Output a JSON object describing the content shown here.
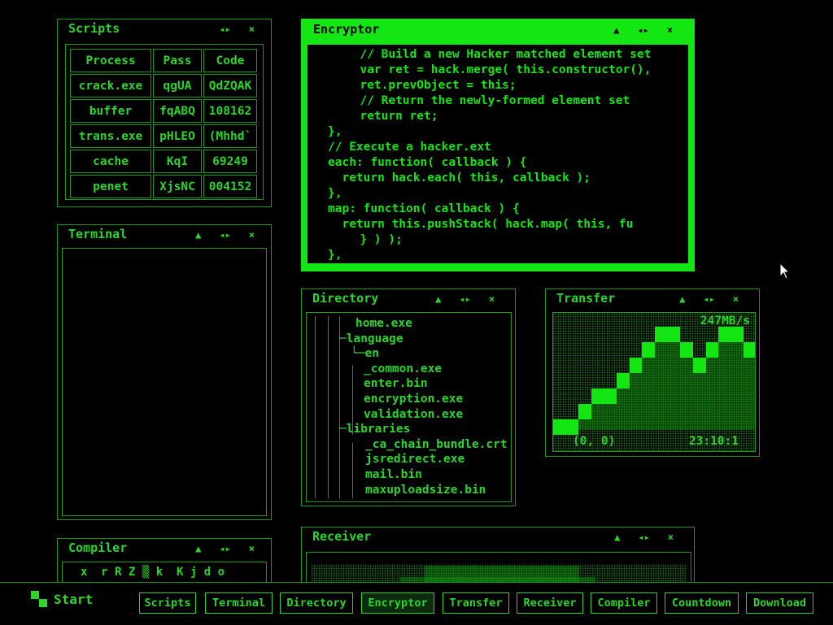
{
  "windows": {
    "scripts": {
      "title": "Scripts",
      "controls": [
        "◂▸",
        "×"
      ],
      "table": {
        "headers": [
          "Process",
          "Pass",
          "Code"
        ],
        "rows": [
          [
            "crack.exe",
            "qgUA",
            "QdZQAK"
          ],
          [
            "buffer",
            "fqABQ",
            "108162"
          ],
          [
            "trans.exe",
            "pHLEO",
            "(Mhhd`"
          ],
          [
            "cache",
            "KqI",
            "69249"
          ],
          [
            "penet",
            "XjsNC",
            "004152"
          ]
        ]
      }
    },
    "terminal": {
      "title": "Terminal",
      "controls": [
        "▲",
        "◂▸",
        "×"
      ]
    },
    "compiler": {
      "title": "Compiler",
      "controls": [
        "▲",
        "◂▸",
        "×"
      ],
      "text": "x  r R Z ▒ k  K j d o"
    },
    "encryptor": {
      "title": "Encryptor",
      "controls": [
        "▲",
        "◂▸",
        "×"
      ],
      "code": [
        "  // Build a new Hacker matched element set",
        "  var ret = hack.merge( this.constructor(),",
        "  ret.prevObject = this;",
        "  // Return the newly-formed element set",
        "  return ret;",
        "},",
        "// Execute a hacker.ext",
        "each: function( callback ) {",
        "  return hack.each( this, callback );",
        "},",
        "map: function( callback ) {",
        "  return this.pushStack( hack.map( this, fu",
        "  } ) );",
        "},"
      ]
    },
    "directory": {
      "title": "Directory",
      "controls": [
        "▲",
        "◂▸",
        "×"
      ],
      "tree": [
        {
          "prefix": "  ",
          "name": "home.exe"
        },
        {
          "prefix": "─",
          "name": "language"
        },
        {
          "prefix": "  └─",
          "name": "en"
        },
        {
          "prefix": "     ",
          "name": "_common.exe"
        },
        {
          "prefix": "     ",
          "name": "enter.bin"
        },
        {
          "prefix": "     ",
          "name": "encryption.exe"
        },
        {
          "prefix": "     ",
          "name": "validation.exe"
        },
        {
          "prefix": "─",
          "name": "libraries"
        },
        {
          "prefix": "     ",
          "name": "_ca_chain_bundle.crt"
        },
        {
          "prefix": "     ",
          "name": "jsredirect.exe"
        },
        {
          "prefix": "     ",
          "name": "mail.bin"
        },
        {
          "prefix": "     ",
          "name": "maxuploadsize.bin"
        }
      ]
    },
    "transfer": {
      "title": "Transfer",
      "controls": [
        "▲",
        "◂▸",
        "×"
      ],
      "speed": "247MB/s",
      "coords": "(0, 0)",
      "time": "23:10:1",
      "levels": [
        1,
        1,
        2,
        3,
        3,
        4,
        5,
        6,
        7,
        7,
        6,
        5,
        6,
        7,
        7,
        6
      ]
    },
    "receiver": {
      "title": "Receiver",
      "controls": [
        "▲",
        "◂▸",
        "×"
      ]
    }
  },
  "taskbar": {
    "start_label": "Start",
    "buttons": [
      "Scripts",
      "Terminal",
      "Directory",
      "Encryptor",
      "Transfer",
      "Receiver",
      "Compiler",
      "Countdown",
      "Download"
    ],
    "active": "Encryptor"
  },
  "colors": {
    "accent": "#14e614",
    "text": "#2bd62b",
    "border": "#1c9a1c",
    "background": "#000000"
  }
}
